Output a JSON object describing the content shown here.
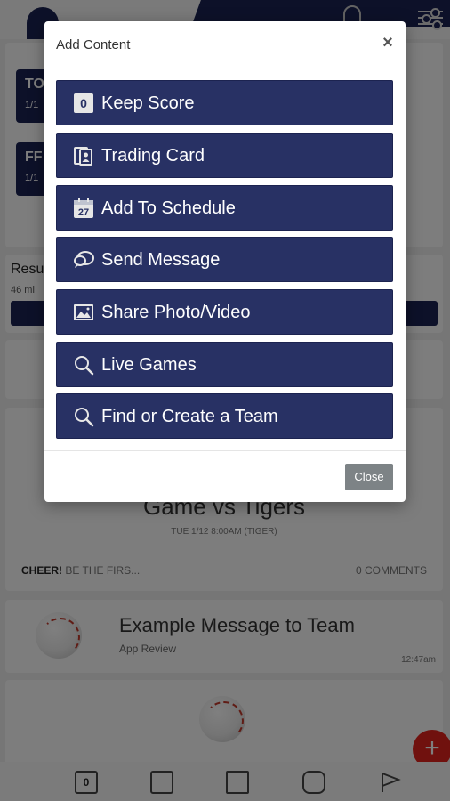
{
  "background": {
    "teams": [
      {
        "abbr": "TO",
        "date": "1/1"
      },
      {
        "abbr": "FF",
        "date": "1/1"
      }
    ],
    "results": {
      "title": "Resu",
      "time": "46 mi"
    },
    "game": {
      "title": "Game vs Tigers",
      "date": "TUE 1/12 8:00AM (TIGER)",
      "cheer_label": "CHEER!",
      "cheer_text": "BE THE FIRS...",
      "comments": "0 COMMENTS"
    },
    "message": {
      "title": "Example Message to Team",
      "subtitle": "App Review",
      "time": "12:47am"
    },
    "fab_label": "+",
    "bottom_nav": {
      "score": "0"
    }
  },
  "modal": {
    "title": "Add Content",
    "close_x": "×",
    "buttons": [
      {
        "label": "Keep Score",
        "icon": "scoreboard-icon"
      },
      {
        "label": "Trading Card",
        "icon": "trading-card-icon"
      },
      {
        "label": "Add To Schedule",
        "icon": "calendar-icon"
      },
      {
        "label": "Send Message",
        "icon": "message-icon"
      },
      {
        "label": "Share Photo/Video",
        "icon": "photo-icon"
      },
      {
        "label": "Live Games",
        "icon": "search-icon"
      },
      {
        "label": "Find or Create a Team",
        "icon": "search-icon"
      }
    ],
    "score_icon_value": "0",
    "calendar_icon_value": "27",
    "close_button": "Close"
  },
  "colors": {
    "button_bg": "#283164",
    "navy": "#1b2353",
    "close_bg": "#7d8386",
    "fab": "#e1231c"
  }
}
